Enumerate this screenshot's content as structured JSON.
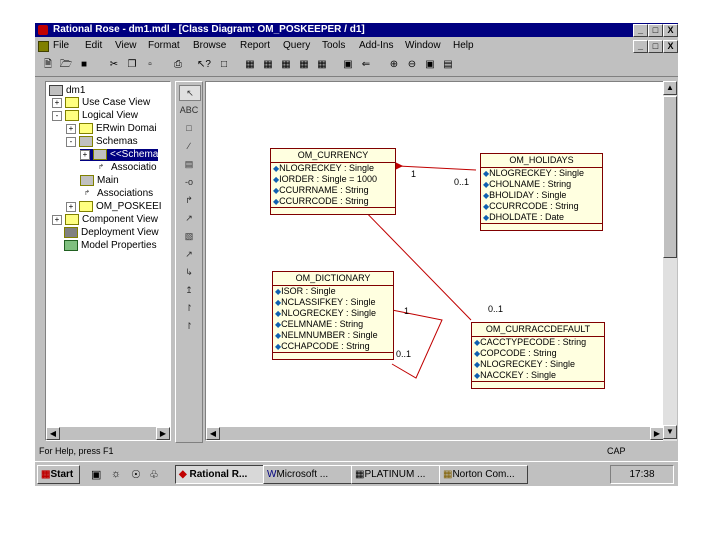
{
  "window": {
    "title": "Rational Rose - dm1.mdl - [Class Diagram: OM_POSKEEPER / d1]",
    "controls": [
      "_",
      "□",
      "X"
    ]
  },
  "menu": [
    "File",
    "Edit",
    "View",
    "Format",
    "Browse",
    "Report",
    "Query",
    "Tools",
    "Add-Ins",
    "Window",
    "Help"
  ],
  "tree": {
    "items": [
      {
        "label": "dm1",
        "level": 0,
        "exp": ""
      },
      {
        "label": "Use Case View",
        "level": 1,
        "exp": "+"
      },
      {
        "label": "Logical View",
        "level": 1,
        "exp": "-"
      },
      {
        "label": "ERwin Domai",
        "level": 2,
        "exp": "+"
      },
      {
        "label": "Schemas",
        "level": 2,
        "exp": "-"
      },
      {
        "label": "<<Schema",
        "level": 3,
        "exp": "+"
      },
      {
        "label": "Associatio",
        "level": 3,
        "exp": ""
      },
      {
        "label": "Main",
        "level": 2,
        "exp": ""
      },
      {
        "label": "Associations",
        "level": 2,
        "exp": ""
      },
      {
        "label": "OM_POSKEEI",
        "level": 2,
        "exp": "+"
      },
      {
        "label": "Component View",
        "level": 1,
        "exp": "+"
      },
      {
        "label": "Deployment View",
        "level": 1,
        "exp": ""
      },
      {
        "label": "Model Properties",
        "level": 1,
        "exp": ""
      }
    ]
  },
  "classes": {
    "currency": {
      "name": "OM_CURRENCY",
      "attrs": [
        "NLOGRECKEY : Single",
        "IORDER : Single = 1000",
        "CCURRNAME : String",
        "CCURRCODE : String"
      ]
    },
    "holidays": {
      "name": "OM_HOLIDAYS",
      "attrs": [
        "NLOGRECKEY : Single",
        "CHOLNAME : String",
        "BHOLIDAY : Single",
        "CCURRCODE : String",
        "DHOLDATE : Date"
      ]
    },
    "dictionary": {
      "name": "OM_DICTIONARY",
      "attrs": [
        "ISOR : Single",
        "NCLASSIFKEY : Single",
        "NLOGRECKEY : Single",
        "CELMNAME : String",
        "NELMNUMBER : Single",
        "CCHAPCODE : String"
      ]
    },
    "curraccdefault": {
      "name": "OM_CURRACCDEFAULT",
      "attrs": [
        "CACCTYPECODE : String",
        "COPCODE : String",
        "NLOGRECKEY : Single",
        "NACCKEY : Single"
      ]
    }
  },
  "edges": {
    "m1": "1",
    "m2": "0..1",
    "m3": "0..1",
    "m4": "1",
    "m5": "0..1"
  },
  "status": {
    "left": "For Help, press F1",
    "right": "CAP"
  },
  "taskbar": {
    "start": "Start",
    "tasks": [
      "Rational R...",
      "Microsoft ...",
      "PLATINUM ...",
      "Norton Com..."
    ],
    "clock": "17:38"
  }
}
